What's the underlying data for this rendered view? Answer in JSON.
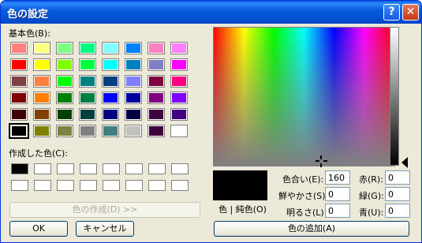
{
  "window": {
    "title": "色の設定",
    "help_glyph": "?",
    "close_glyph": "✕"
  },
  "basic_colors_label": "基本色(B):",
  "basic_colors": [
    "#ff8080",
    "#ffff80",
    "#80ff80",
    "#00ff80",
    "#80ffff",
    "#0080ff",
    "#ff80c0",
    "#ff80ff",
    "#ff0000",
    "#ffff00",
    "#80ff00",
    "#00ff40",
    "#00ffff",
    "#0080c0",
    "#8080c0",
    "#ff00ff",
    "#804040",
    "#ff8040",
    "#00ff00",
    "#008080",
    "#004080",
    "#8080ff",
    "#800040",
    "#ff0080",
    "#800000",
    "#ff8000",
    "#008000",
    "#008040",
    "#0000ff",
    "#0000a0",
    "#800080",
    "#8000ff",
    "#400000",
    "#804000",
    "#004000",
    "#004040",
    "#000080",
    "#000040",
    "#400040",
    "#400080",
    "#000000",
    "#808000",
    "#808040",
    "#808080",
    "#408080",
    "#c0c0c0",
    "#400040",
    "#ffffff"
  ],
  "custom_colors_label": "作成した色(C):",
  "custom_colors": [
    "#000000",
    "#ffffff",
    "#ffffff",
    "#ffffff",
    "#ffffff",
    "#ffffff",
    "#ffffff",
    "#ffffff",
    "#ffffff",
    "#ffffff",
    "#ffffff",
    "#ffffff",
    "#ffffff",
    "#ffffff",
    "#ffffff",
    "#ffffff"
  ],
  "define_custom_button": "色の作成(D) >>",
  "ok_button": "OK",
  "cancel_button": "キャンセル",
  "preview_label": "色 | 純色(O)",
  "fields": {
    "hue_label": "色合い(E):",
    "hue": "160",
    "sat_label": "鮮やかさ(S):",
    "sat": "0",
    "lum_label": "明るさ(L):",
    "lum": "0",
    "red_label": "赤(R):",
    "red": "0",
    "green_label": "緑(G):",
    "green": "0",
    "blue_label": "青(U):",
    "blue": "0"
  },
  "add_custom_button": "色の追加(A)"
}
